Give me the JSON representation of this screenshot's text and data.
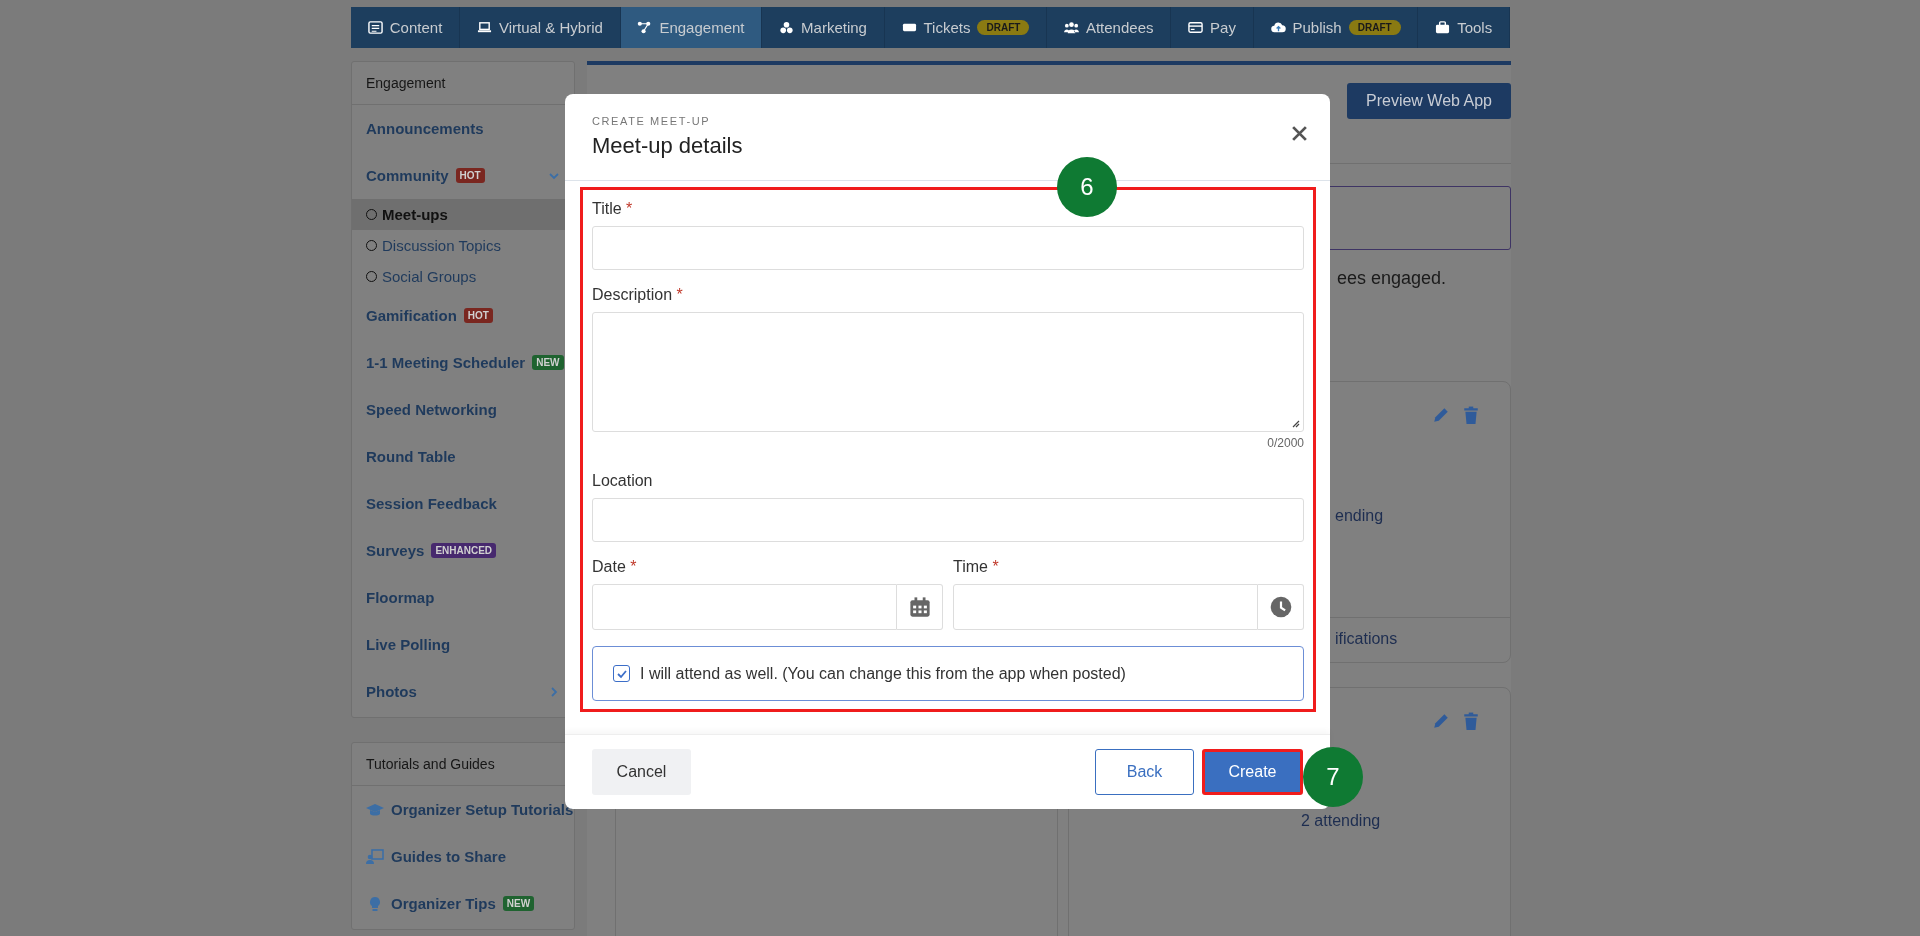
{
  "nav_tabs": [
    {
      "label": "Content",
      "selected": false
    },
    {
      "label": "Virtual & Hybrid",
      "selected": false
    },
    {
      "label": "Engagement",
      "selected": true
    },
    {
      "label": "Marketing",
      "selected": false
    },
    {
      "label": "Tickets",
      "badge": "DRAFT",
      "selected": false
    },
    {
      "label": "Attendees",
      "selected": false
    },
    {
      "label": "Pay",
      "selected": false
    },
    {
      "label": "Publish",
      "badge": "DRAFT",
      "selected": false
    },
    {
      "label": "Tools",
      "selected": false
    }
  ],
  "sidebar": {
    "title": "Engagement",
    "items": [
      {
        "label": "Announcements"
      },
      {
        "label": "Community",
        "badge": {
          "text": "HOT",
          "color": "#7a2720"
        },
        "expanded": true,
        "children": [
          {
            "label": "Meet-ups",
            "selected": true
          },
          {
            "label": "Discussion Topics",
            "selected": false
          },
          {
            "label": "Social Groups",
            "selected": false
          }
        ]
      },
      {
        "label": "Gamification",
        "badge": {
          "text": "HOT",
          "color": "#7a2720"
        }
      },
      {
        "label": "1-1 Meeting Scheduler",
        "badge": {
          "text": "NEW",
          "color": "#1f6330"
        }
      },
      {
        "label": "Speed Networking"
      },
      {
        "label": "Round Table"
      },
      {
        "label": "Session Feedback"
      },
      {
        "label": "Surveys",
        "badge": {
          "text": "ENHANCED",
          "color": "#47296e"
        }
      },
      {
        "label": "Floormap"
      },
      {
        "label": "Live Polling"
      },
      {
        "label": "Photos",
        "expanded": false
      }
    ]
  },
  "tutorials": {
    "title": "Tutorials and Guides",
    "items": [
      {
        "label": "Organizer Setup Tutorials"
      },
      {
        "label": "Guides to Share"
      },
      {
        "label": "Organizer Tips",
        "badge": {
          "text": "NEW",
          "color": "#1f6330"
        }
      }
    ]
  },
  "page": {
    "preview_button": "Preview Web App",
    "intro_fragment": "ees engaged.",
    "cards": [
      {
        "attending_fragment": "ending",
        "footer_fragment": "ifications"
      },
      {
        "attending_fragment": "2 attending"
      }
    ]
  },
  "modal": {
    "eyebrow": "CREATE MEET-UP",
    "title": "Meet-up details",
    "fields": [
      {
        "kind": "text",
        "label": "Title",
        "required_mark": "*"
      },
      {
        "kind": "textarea",
        "label": "Description",
        "required_mark": "*",
        "counter": "0/2000"
      },
      {
        "kind": "text",
        "label": "Location"
      },
      {
        "kind": "date",
        "label": "Date",
        "required_mark": "*"
      },
      {
        "kind": "time",
        "label": "Time",
        "required_mark": "*"
      }
    ],
    "checkbox": {
      "label": "I will attend as well. (You can change this from the app when posted)",
      "checked": true
    },
    "buttons": {
      "cancel": "Cancel",
      "back": "Back",
      "create": "Create"
    }
  },
  "step_markers": [
    "6",
    "7"
  ]
}
